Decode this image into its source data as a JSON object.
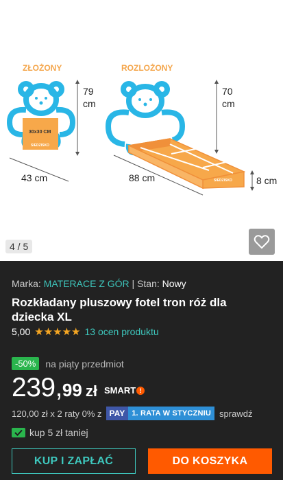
{
  "gallery": {
    "counter": "4 / 5",
    "favorite_icon": "heart-outline-icon",
    "illustration": {
      "folded_label": "ZŁOŻONY",
      "unfolded_label": "ROZLOŻONY",
      "folded_height": "79",
      "folded_height_unit": "cm",
      "folded_width": "43 cm",
      "seat_size": "30x30 CM",
      "seat_label": "SIEDZISKO",
      "unfolded_height": "70",
      "unfolded_height_unit": "cm",
      "unfolded_length": "88 cm",
      "mattress_thickness": "8 cm",
      "mattress_label": "SIEDZISKO",
      "colors": {
        "teddy": "#29b6e6",
        "seat": "#f7a84a",
        "seat_border": "#f0903a",
        "labels": "#f4a54a"
      }
    }
  },
  "product": {
    "brand_prefix": "Marka: ",
    "brand": "MATERACE Z GÓR",
    "condition_prefix": " | Stan: ",
    "condition": "Nowy",
    "title": "Rozkładany pluszowy fotel tron róż dla dziecka XL",
    "rating_score": "5,00",
    "stars": "★★★★★",
    "reviews": "13 ocen produktu"
  },
  "promo": {
    "badge": "-50%",
    "text": "na piąty przedmiot"
  },
  "price": {
    "integer": "239,",
    "decimal": "99",
    "currency": "zł",
    "smart": "SMART",
    "smart_mark": "!"
  },
  "installments": {
    "text": "120,00 zł x 2 raty 0% z",
    "pay_logo": "PAY",
    "pay_text": "1. RATA W STYCZNIU",
    "suffix": "sprawdź"
  },
  "coupon": {
    "text": "kup 5 zł taniej"
  },
  "actions": {
    "buy_now": "KUP I ZAPŁAĆ",
    "add_to_cart": "DO KOSZYKA"
  },
  "colors": {
    "accent_teal": "#3ec7bd",
    "accent_orange": "#ff5a00",
    "discount_green": "#2ab54d",
    "panel_bg": "#222222"
  }
}
